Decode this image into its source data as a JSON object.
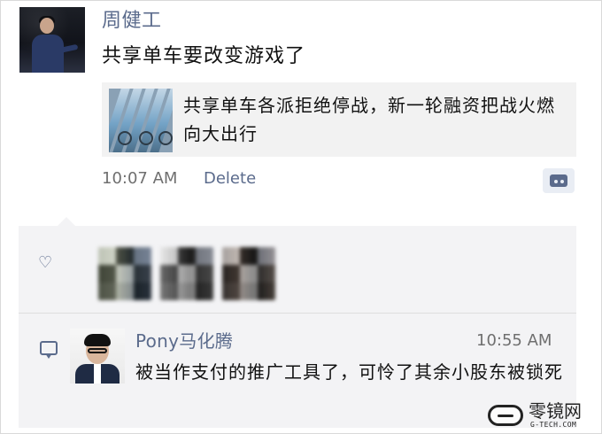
{
  "post": {
    "author": "周健工",
    "text": "共享单车要改变游戏了",
    "link_card": {
      "title": "共享单车各派拒绝停战，新一轮融资把战火燃向大出行"
    },
    "meta": {
      "time": "10:07 AM",
      "delete_label": "Delete"
    }
  },
  "comments": [
    {
      "author": "Pony马化腾",
      "time": "10:55 AM",
      "text": "被当作支付的推广工具了，可怜了其余小股东被锁死"
    }
  ],
  "likes": {
    "blurred_avatars": [
      {
        "icon": "blurred-avatar"
      },
      {
        "icon": "blurred-avatar"
      },
      {
        "icon": "blurred-avatar"
      }
    ]
  },
  "watermark": {
    "cn": "零镜网",
    "en": "G-TECH.COM"
  },
  "colors": {
    "name_blue": "#5b6b8c",
    "meta_gray": "#6f6f6f",
    "panel_bg": "#f3f3f5",
    "link_bg": "#f2f2f2"
  },
  "icons": {
    "like": "heart-icon",
    "comment": "comment-icon",
    "more": "comment-menu-icon",
    "logo": "watermark-logo-icon"
  }
}
